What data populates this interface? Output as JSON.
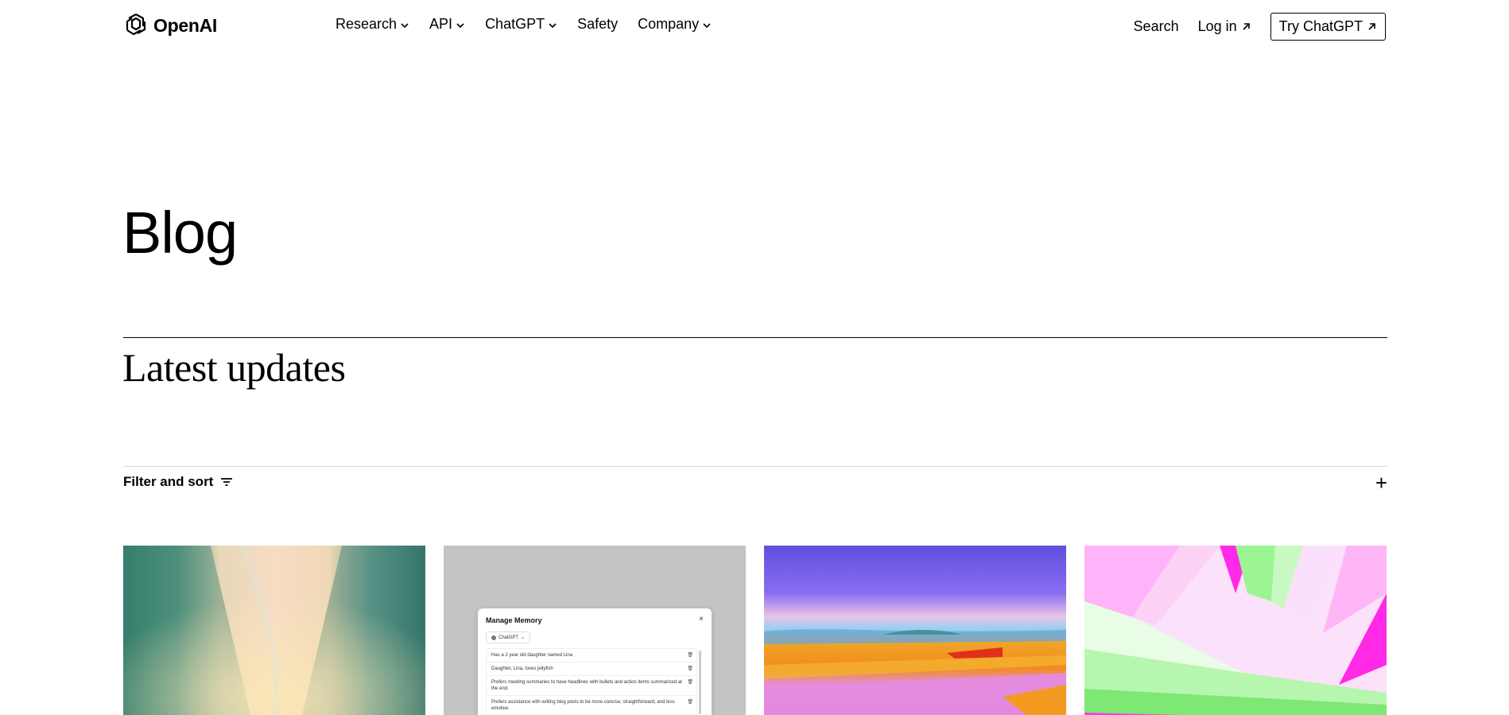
{
  "brand": {
    "name": "OpenAI"
  },
  "nav": {
    "items": [
      {
        "label": "Research"
      },
      {
        "label": "API"
      },
      {
        "label": "ChatGPT"
      },
      {
        "label": "Safety"
      },
      {
        "label": "Company"
      }
    ],
    "search_label": "Search",
    "login_label": "Log in",
    "try_label": "Try ChatGPT"
  },
  "page": {
    "title": "Blog",
    "section_title": "Latest updates",
    "filter_label": "Filter and sort",
    "expand_symbol": "+"
  },
  "cards": {
    "memory": {
      "title": "Manage Memory",
      "close": "×",
      "chip": "ChatGPT",
      "chip_chevron": "⌄",
      "items": [
        "Has a 2 year old daughter named Lina",
        "Daughter, Lina, loves jellyfish",
        "Prefers meeting summaries to have headlines with bullets and action items summarized at the end.",
        "Prefers assistance with writing blog posts to be more concise, straightforward, and less emotive."
      ],
      "trash_icon": "🗑"
    }
  },
  "colors": {
    "text": "#000000",
    "divider_light": "#d9d9d9",
    "card2_bg": "#c4c4c4"
  }
}
